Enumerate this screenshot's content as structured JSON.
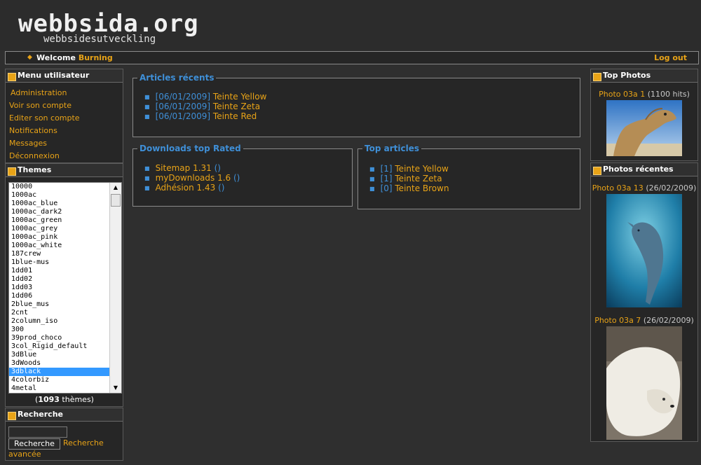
{
  "header": {
    "logo_main": "webbsida.org",
    "logo_sub": "webbsidesutveckling",
    "welcome_prefix": "Welcome ",
    "welcome_user": "Burning",
    "logout": "Log out"
  },
  "user_menu": {
    "title": "Menu utilisateur",
    "items": [
      "Administration",
      "Voir son compte",
      "Editer son compte",
      "Notifications",
      "Messages",
      "Déconnexion"
    ]
  },
  "themes": {
    "title": "Themes",
    "options": [
      "10000",
      "1000ac",
      "1000ac_blue",
      "1000ac_dark2",
      "1000ac_green",
      "1000ac_grey",
      "1000ac_pink",
      "1000ac_white",
      "187crew",
      "1blue-mus",
      "1dd01",
      "1dd02",
      "1dd03",
      "1dd06",
      "2blue_mus",
      "2cnt",
      "2column_iso",
      "300",
      "39prod_choco",
      "3col_Rigid_default",
      "3dBlue",
      "3dWoods",
      "3dblack",
      "4colorbiz",
      "4metal"
    ],
    "selected": "3dblack",
    "count": "1093",
    "count_suffix": " thèmes)",
    "count_prefix": "("
  },
  "search": {
    "title": "Recherche",
    "button": "Recherche",
    "advanced_1": "Recherche",
    "advanced_2": "avancée"
  },
  "recent_articles": {
    "title": "Articles récents",
    "items": [
      {
        "date": "[06/01/2009]",
        "title": "Teinte Yellow"
      },
      {
        "date": "[06/01/2009]",
        "title": "Teinte Zeta"
      },
      {
        "date": "[06/01/2009]",
        "title": "Teinte Red"
      }
    ]
  },
  "downloads": {
    "title": "Downloads top Rated",
    "items": [
      {
        "name": "Sitemap 1.31",
        "extra": "()"
      },
      {
        "name": "myDownloads 1.6",
        "extra": "()"
      },
      {
        "name": "Adhésion 1.43",
        "extra": "()"
      }
    ]
  },
  "top_articles": {
    "title": "Top articles",
    "items": [
      {
        "rank": "[1]",
        "title": "Teinte Yellow"
      },
      {
        "rank": "[1]",
        "title": "Teinte Zeta"
      },
      {
        "rank": "[0]",
        "title": "Teinte Brown"
      }
    ]
  },
  "top_photos": {
    "title": "Top Photos",
    "photo": {
      "name": "Photo 03a 1",
      "info": "(1100 hits)",
      "icon": "camel-photo"
    }
  },
  "recent_photos": {
    "title": "Photos récentes",
    "photos": [
      {
        "name": "Photo 03a 13",
        "info": "(26/02/2009)",
        "icon": "dolphin-photo"
      },
      {
        "name": "Photo 03a 7",
        "info": "(26/02/2009)",
        "icon": "polar-bear-photo"
      }
    ]
  },
  "colors": {
    "accent": "#e8a317",
    "link_blue": "#3f8fd7",
    "background": "#2f2f2f"
  }
}
